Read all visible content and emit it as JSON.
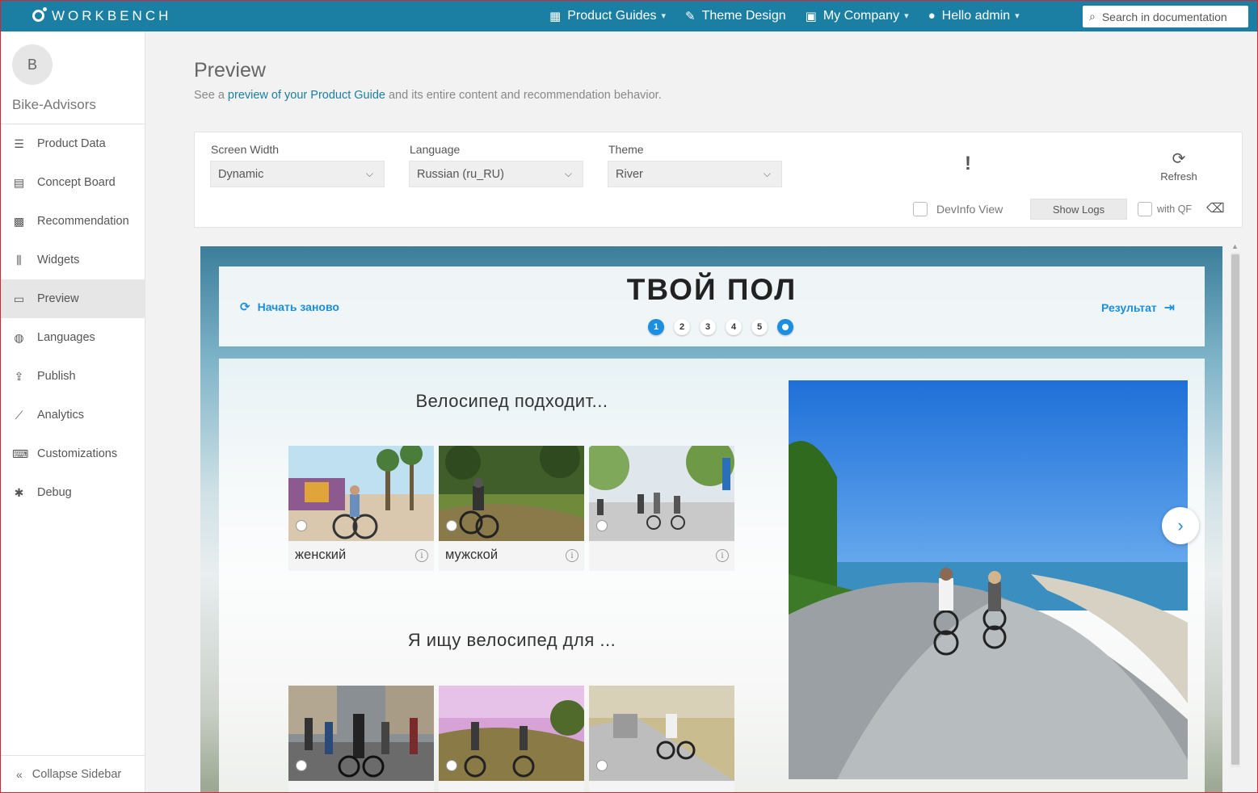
{
  "topbar": {
    "logo_text": "WORKBENCH",
    "nav": [
      {
        "label": "Product Guides",
        "icon": "grid-icon"
      },
      {
        "label": "Theme Design",
        "icon": "brush-icon"
      },
      {
        "label": "My Company",
        "icon": "briefcase-icon"
      },
      {
        "label": "Hello admin",
        "icon": "user-icon"
      }
    ],
    "search_placeholder": "Search in documentation"
  },
  "sidebar": {
    "avatar_letter": "B",
    "company": "Bike-Advisors",
    "items": [
      {
        "label": "Product Data",
        "icon": "database-icon"
      },
      {
        "label": "Concept Board",
        "icon": "board-icon"
      },
      {
        "label": "Recommendation",
        "icon": "gift-icon"
      },
      {
        "label": "Widgets",
        "icon": "sliders-icon"
      },
      {
        "label": "Preview",
        "icon": "monitor-icon",
        "active": true
      },
      {
        "label": "Languages",
        "icon": "globe-icon"
      },
      {
        "label": "Publish",
        "icon": "upload-icon"
      },
      {
        "label": "Analytics",
        "icon": "chart-icon"
      },
      {
        "label": "Customizations",
        "icon": "keyboard-icon"
      },
      {
        "label": "Debug",
        "icon": "bug-icon"
      }
    ],
    "collapse_label": "Collapse Sidebar"
  },
  "main": {
    "title": "Preview",
    "subtitle_before": "See a ",
    "subtitle_link": "preview of your Product Guide",
    "subtitle_after": " and its entire content and recommendation behavior."
  },
  "controls": {
    "screen_width_label": "Screen Width",
    "screen_width_value": "Dynamic",
    "language_label": "Language",
    "language_value": "Russian (ru_RU)",
    "theme_label": "Theme",
    "theme_value": "River",
    "warning_mark": "!",
    "refresh_label": "Refresh",
    "devinfo_label": "DevInfo View",
    "show_logs_label": "Show Logs",
    "with_qf_label": "with QF"
  },
  "guide": {
    "restart_label": "Начать заново",
    "question_title": "ТВОЙ ПОЛ",
    "steps": [
      "1",
      "2",
      "3",
      "4",
      "5"
    ],
    "result_label": "Результат",
    "question1": "Велосипед подходит...",
    "options1": [
      {
        "label": "женский"
      },
      {
        "label": "мужской"
      },
      {
        "label": ""
      }
    ],
    "question2": "Я ищу велосипед для ..."
  },
  "colors": {
    "topbar": "#1a7fa3",
    "accent": "#1a8fe0",
    "sidebar_active": "#e6e6e6"
  }
}
